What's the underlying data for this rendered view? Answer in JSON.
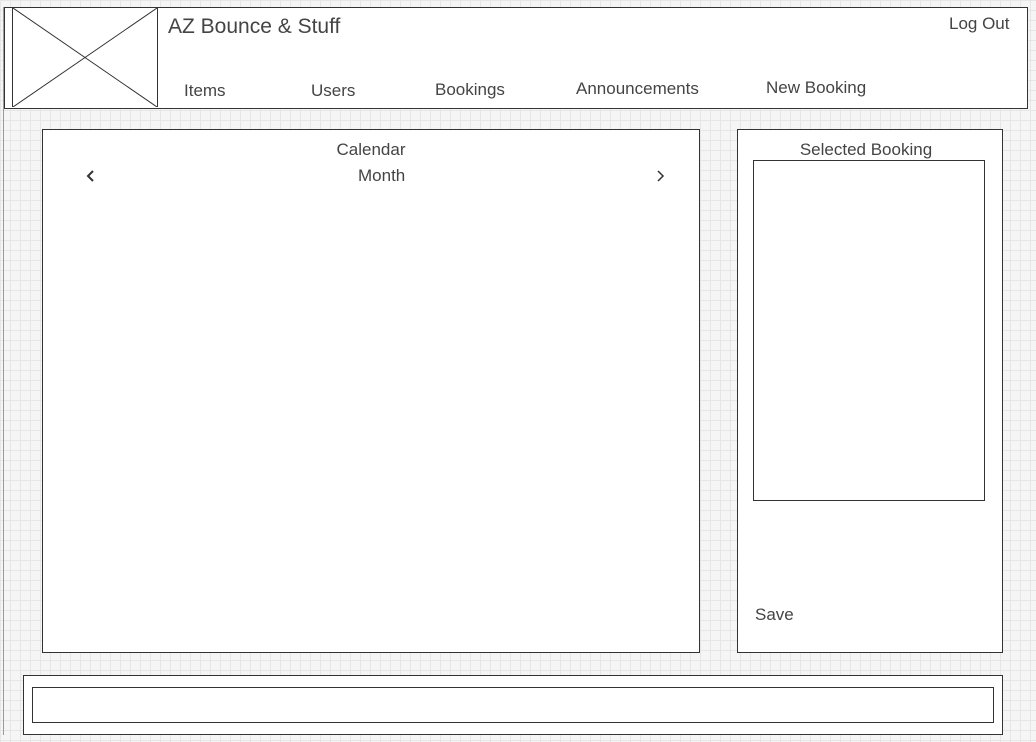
{
  "header": {
    "logo_icon": "image-placeholder-icon",
    "title": "AZ Bounce & Stuff",
    "logout_label": "Log Out",
    "nav": [
      {
        "label": "Items"
      },
      {
        "label": "Users"
      },
      {
        "label": "Bookings"
      },
      {
        "label": "Announcements"
      },
      {
        "label": "New Booking"
      }
    ]
  },
  "calendar": {
    "title": "Calendar",
    "view_label": "Month",
    "prev_icon": "chevron-left-icon",
    "next_icon": "chevron-right-icon"
  },
  "selected_booking": {
    "title": "Selected Booking",
    "save_label": "Save"
  },
  "footer": {
    "input_value": ""
  }
}
